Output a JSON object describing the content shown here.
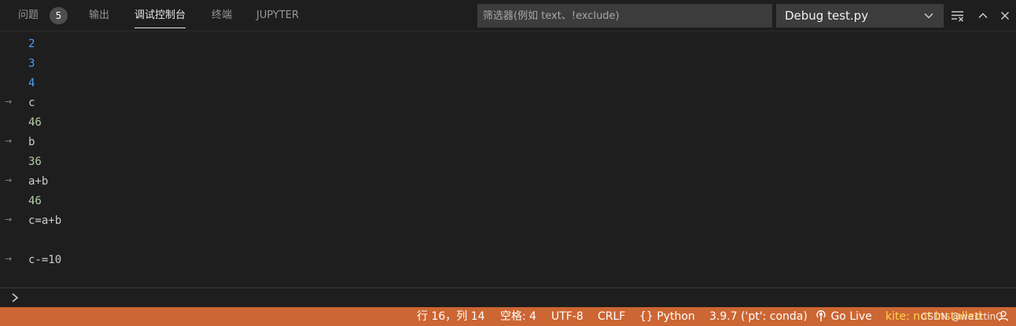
{
  "panel": {
    "tabs": [
      {
        "label": "问题"
      },
      {
        "label": "输出"
      },
      {
        "label": "调试控制台"
      },
      {
        "label": "终端"
      },
      {
        "label": "JUPYTER"
      }
    ],
    "problems_count": "5",
    "filter_placeholder": "筛选器(例如 text、!exclude)",
    "session_label": "Debug test.py",
    "icons": [
      "chevron-down-icon",
      "clear-console-icon",
      "maximize-panel-icon",
      "close-panel-icon"
    ]
  },
  "console": {
    "lines": [
      {
        "text": "2",
        "kind": "output-blue"
      },
      {
        "text": "3",
        "kind": "output-blue"
      },
      {
        "text": "4",
        "kind": "output-blue"
      },
      {
        "text": "c",
        "kind": "input"
      },
      {
        "text": "46",
        "kind": "result"
      },
      {
        "text": "b",
        "kind": "input"
      },
      {
        "text": "36",
        "kind": "result"
      },
      {
        "text": "a+b",
        "kind": "input"
      },
      {
        "text": "46",
        "kind": "result"
      },
      {
        "text": "c=a+b",
        "kind": "input"
      },
      {
        "text": "c-=10",
        "kind": "input"
      }
    ],
    "prompt_icon": "chevron-right-icon"
  },
  "status_bar": {
    "position": "行 16，列 14",
    "spaces": "空格: 4",
    "encoding": "UTF-8",
    "eol": "CRLF",
    "language": "Python",
    "interpreter": "3.9.7 ('pt': conda)",
    "go_live": "Go Live",
    "kite": "kite: not installed",
    "watermark": "CSDN @wa1ttinG"
  },
  "colors": {
    "status_bar_bg": "#cc6633",
    "console_bg": "#1e1e1e",
    "output_blue": "#4a9ff5",
    "result_green": "#b5cea8"
  }
}
